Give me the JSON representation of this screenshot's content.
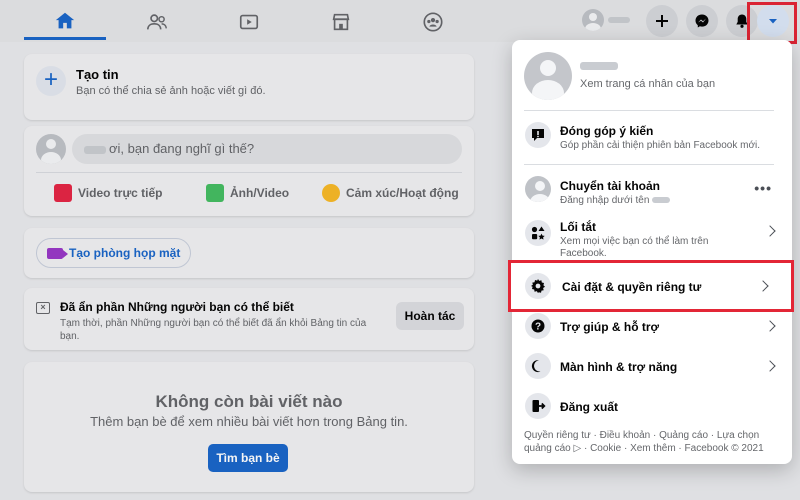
{
  "topbar": {
    "nav": [
      {
        "name": "home",
        "active": true
      },
      {
        "name": "friends",
        "active": false
      },
      {
        "name": "watch",
        "active": false
      },
      {
        "name": "marketplace",
        "active": false
      },
      {
        "name": "groups",
        "active": false
      }
    ],
    "icons": {
      "create": "plus-icon",
      "messenger": "messenger-icon",
      "notifications": "bell-icon",
      "account": "caret-down-icon"
    }
  },
  "feed": {
    "story": {
      "title": "Tạo tin",
      "subtitle": "Bạn có thể chia sẻ ảnh hoặc viết gì đó."
    },
    "composer": {
      "placeholder": "ơi, bạn đang nghĩ gì thế?",
      "actions": [
        {
          "label": "Video trực tiếp",
          "color": "#e42645"
        },
        {
          "label": "Ảnh/Video",
          "color": "#45bd62"
        },
        {
          "label": "Cảm xúc/Hoạt động",
          "color": "#f7b928"
        }
      ]
    },
    "room": {
      "label": "Tạo phòng họp mặt"
    },
    "hidden": {
      "title": "Đã ẩn phần Những người bạn có thể biết",
      "subtitle": "Tạm thời, phần Những người bạn có thể biết đã ẩn khỏi Bảng tin của bạn.",
      "undo_label": "Hoàn tác"
    },
    "empty": {
      "title": "Không còn bài viết nào",
      "subtitle": "Thêm bạn bè để xem nhiều bài viết hơn trong Bảng tin.",
      "button": "Tìm bạn bè"
    }
  },
  "menu": {
    "profile": {
      "subtitle": "Xem trang cá nhân của bạn"
    },
    "feedback": {
      "title": "Đóng góp ý kiến",
      "subtitle": "Góp phần cải thiện phiên bản Facebook mới."
    },
    "switch_account": {
      "title": "Chuyển tài khoản",
      "subtitle": "Đăng nhập dưới tên"
    },
    "shortcuts": {
      "title": "Lối tắt",
      "subtitle": "Xem mọi việc bạn có thể làm trên Facebook."
    },
    "settings": {
      "title": "Cài đặt & quyền riêng tư"
    },
    "help": {
      "title": "Trợ giúp & hỗ trợ"
    },
    "display": {
      "title": "Màn hình & trợ năng"
    },
    "logout": {
      "title": "Đăng xuất"
    },
    "footer": "Quyền riêng tư · Điều khoản · Quảng cáo · Lựa chọn quảng cáo ▷ · Cookie · Xem thêm · Facebook © 2021"
  },
  "colors": {
    "accent": "#1b66c9",
    "highlight_border": "#e32636"
  }
}
